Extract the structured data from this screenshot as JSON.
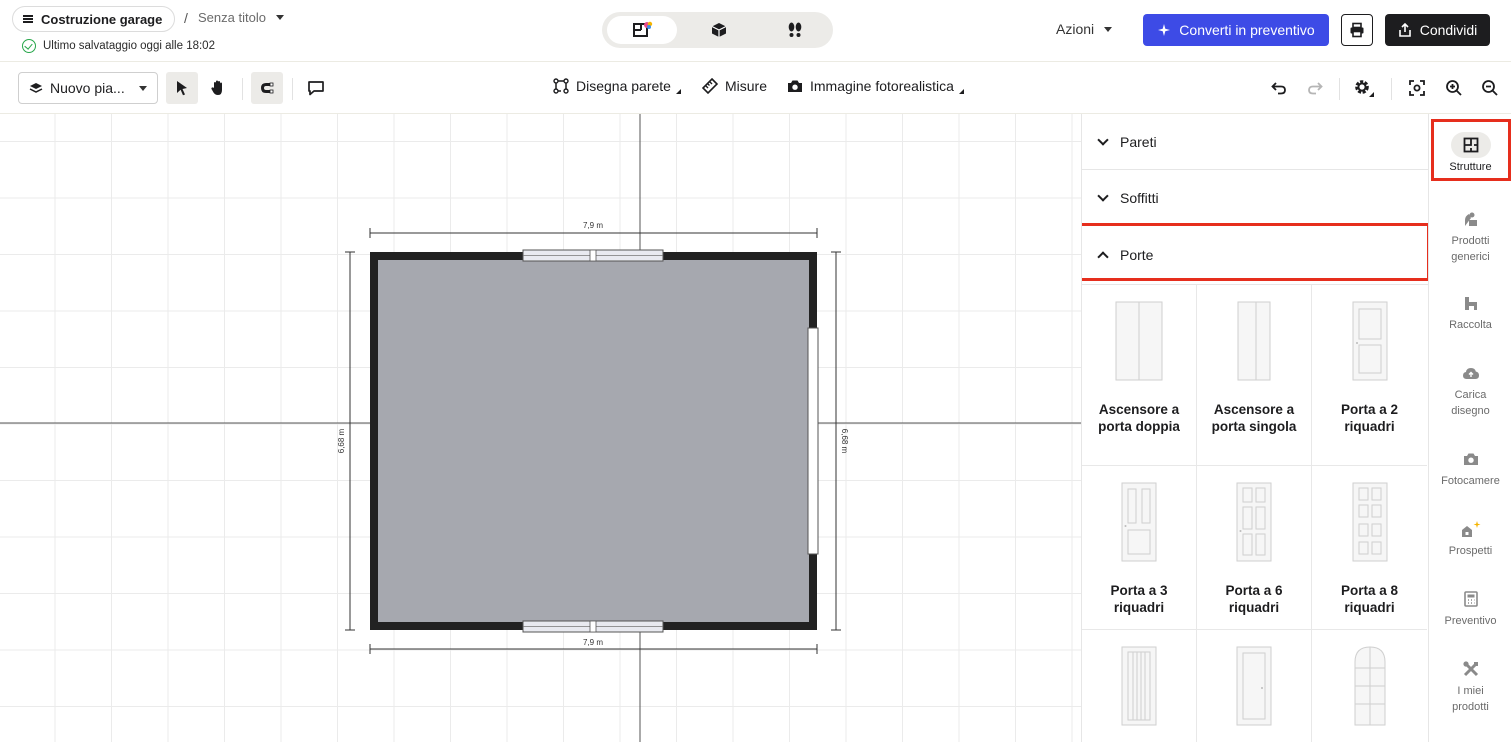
{
  "header": {
    "project_name": "Costruzione garage",
    "breadcrumb_separator": "/",
    "doc_title": "Senza titolo",
    "save_status": "Ultimo salvataggio oggi alle 18:02",
    "actions_label": "Azioni",
    "convert_label": "Converti in preventivo",
    "share_label": "Condividi",
    "accent_color": "#3d4be6"
  },
  "toolbar": {
    "floor_select": "Nuovo pia...",
    "draw_wall": "Disegna parete",
    "measures": "Misure",
    "photo_image": "Immagine fotorealistica"
  },
  "canvas": {
    "top_dimension": "7,9 m",
    "bottom_dimension": "7,9 m",
    "left_dimension": "6,68 m",
    "right_dimension": "6,68 m"
  },
  "panel": {
    "sections": [
      "Pareti",
      "Soffitti",
      "Porte"
    ],
    "items": [
      "Ascensore a porta doppia",
      "Ascensore a porta singola",
      "Porta a 2 riquadri",
      "Porta a 3 riquadri",
      "Porta a 6 riquadri",
      "Porta a 8 riquadri"
    ]
  },
  "rail": {
    "items": [
      "Strutture",
      "Prodotti generici",
      "Raccolta",
      "Carica disegno",
      "Fotocamere",
      "Prospetti",
      "Preventivo",
      "I miei prodotti"
    ]
  }
}
